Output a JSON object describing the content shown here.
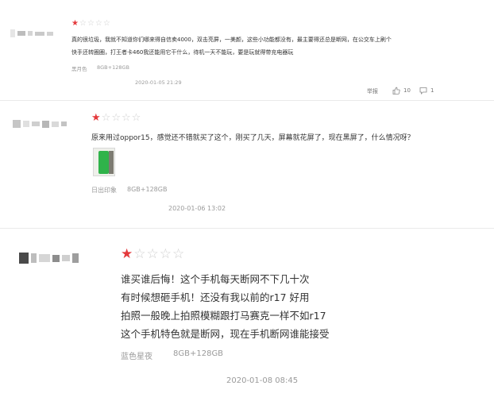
{
  "reviews": [
    {
      "rating": 1,
      "max_rating": 5,
      "lines": [
        "真的很垃圾，我就不知道你们哪来得自信卖4000，双击亮屏，一美颜，这些小功能都没有，最主要得还总是断网，在公交车上刷个",
        "快手还转圈圈，打王者卡460我还能用它干什么，待机一天不能玩，要是玩就得带充电器玩"
      ],
      "color": "黑月色",
      "spec": "8GB+128GB",
      "date": "2020-01-05 21:29",
      "actions": {
        "report_label": "举报",
        "like_count": "10",
        "reply_count": "1"
      }
    },
    {
      "rating": 1,
      "max_rating": 5,
      "lines": [
        "原来用过oppor15，感觉还不错就买了这个，刚买了几天，屏幕就花屏了，现在黑屏了，什么情况呀？"
      ],
      "color": "日出印象",
      "spec": "8GB+128GB",
      "date": "2020-01-06 13:02"
    },
    {
      "rating": 1,
      "max_rating": 5,
      "lines": [
        "谁买谁后悔！这个手机每天断网不下几十次",
        "有时候想砸手机！还没有我以前的r17 好用",
        "拍照一般晚上拍照模糊跟打马赛克一样不如r17",
        "这个手机特色就是断网，现在手机断网谁能接受"
      ],
      "color": "蓝色星夜",
      "spec": "8GB+128GB",
      "date": "2020-01-08 08:45"
    }
  ],
  "colors": {
    "star_active": "#e4393c",
    "star_inactive": "#cfcfcf",
    "meta_text": "#9a9a9a",
    "photo_green": "#2fb34a"
  }
}
